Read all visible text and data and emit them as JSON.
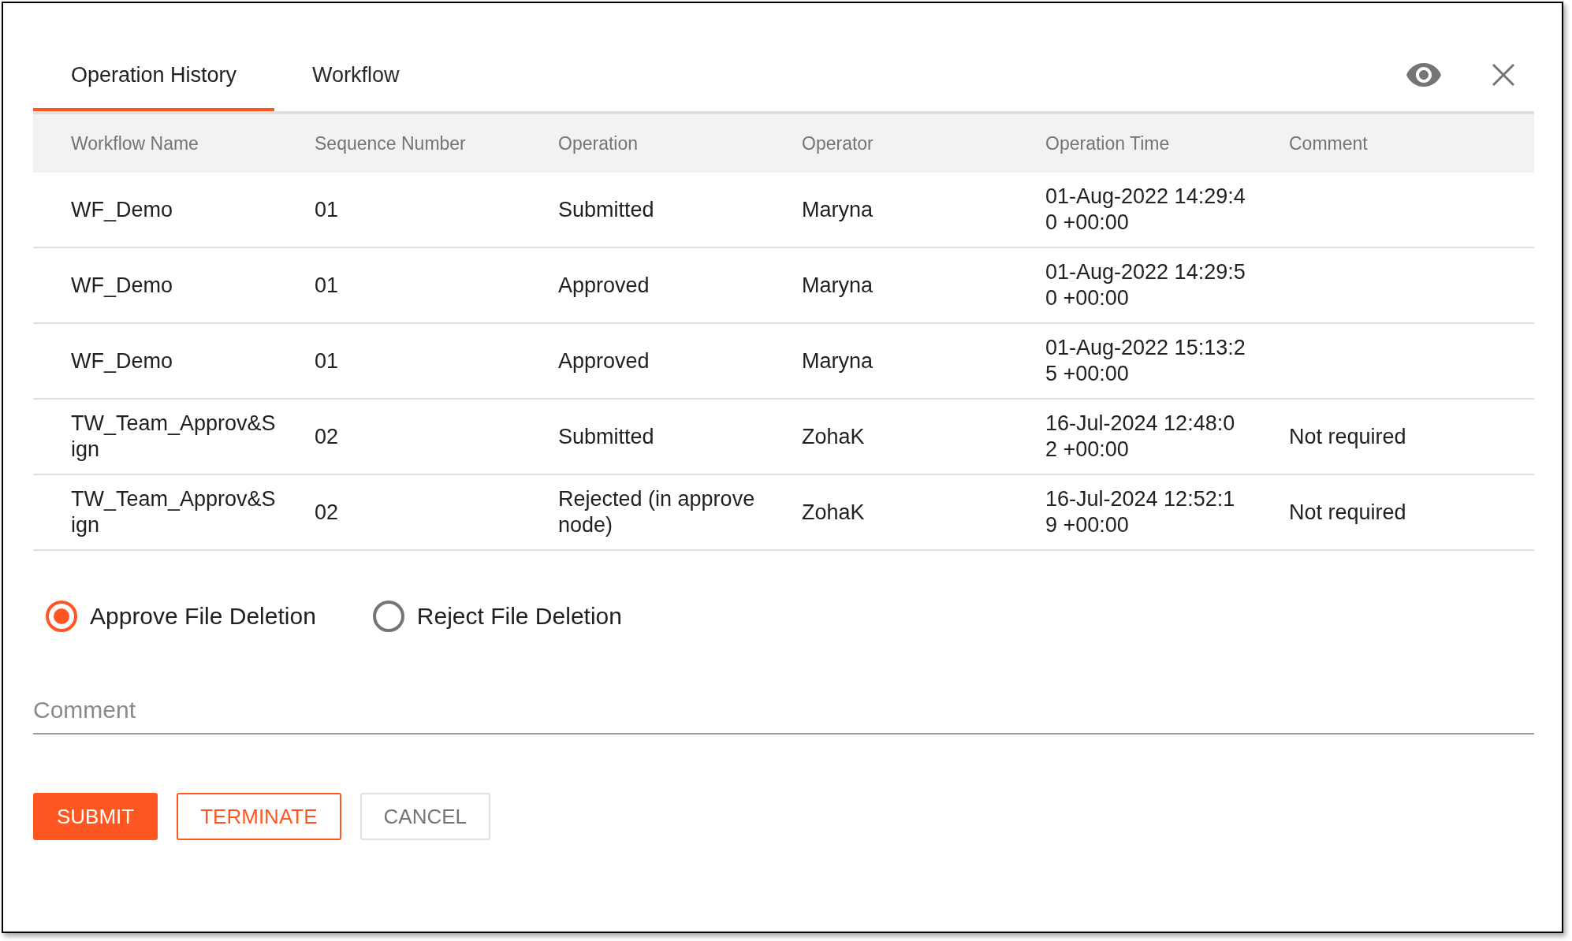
{
  "tabs": [
    {
      "label": "Operation History",
      "selected": true
    },
    {
      "label": "Workflow",
      "selected": false
    }
  ],
  "table": {
    "columns": [
      "Workflow Name",
      "Sequence Number",
      "Operation",
      "Operator",
      "Operation Time",
      "Comment"
    ],
    "rows": [
      {
        "cells": [
          "WF_Demo",
          "01",
          "Submitted",
          "Maryna",
          "01-Aug-2022 14:29:40 +00:00"
        ]
      },
      {
        "cells": [
          "WF_Demo",
          "01",
          "Approved",
          "Maryna",
          "01-Aug-2022 14:29:50 +00:00"
        ]
      },
      {
        "cells": [
          "WF_Demo",
          "01",
          "Approved",
          "Maryna",
          "01-Aug-2022 15:13:25 +00:00"
        ]
      },
      {
        "cells": [
          "TW_Team_Approv&Sign",
          "02",
          "Submitted",
          "ZohaK",
          "16-Jul-2024 12:48:02 +00:00",
          "Not required"
        ]
      },
      {
        "cells": [
          "TW_Team_Approv&Sign",
          "02",
          "Rejected (in approve node)",
          "ZohaK",
          "16-Jul-2024 12:52:19 +00:00",
          "Not required"
        ]
      }
    ]
  },
  "decision": [
    {
      "label": "Approve File Deletion",
      "selected": true
    },
    {
      "label": "Reject File Deletion",
      "selected": false
    }
  ],
  "comment": {
    "placeholder": "Comment"
  },
  "buttons": [
    {
      "label": "SUBMIT",
      "kind": "primary"
    },
    {
      "label": "TERMINATE",
      "kind": "outlined"
    },
    {
      "label": "CANCEL",
      "kind": "default"
    }
  ]
}
